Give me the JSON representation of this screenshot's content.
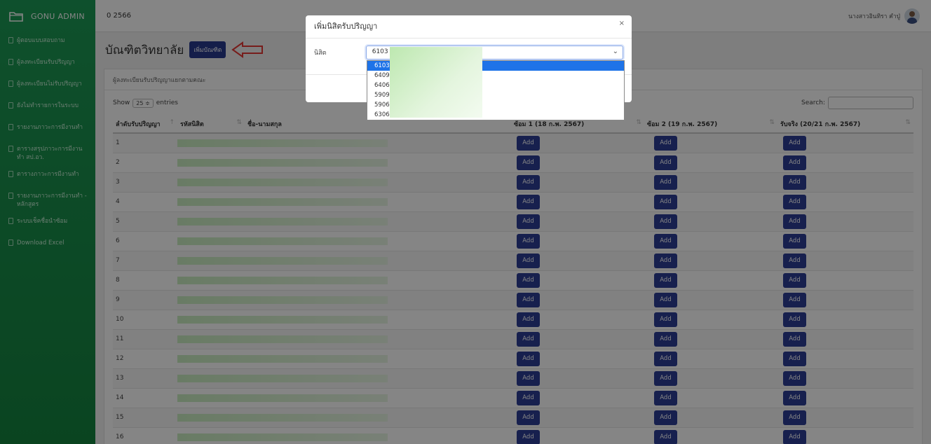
{
  "brand": {
    "name": "GONU ADMIN",
    "icon": "folder-icon"
  },
  "topbar": {
    "year": "0 2566",
    "user_name": "นางสาวอินทิรา คำปู่"
  },
  "sidebar": {
    "items": [
      {
        "label": "ผู้ตอบแบบสอบถาม"
      },
      {
        "label": "ผู้ลงทะเบียนรับปริญญา"
      },
      {
        "label": "ผู้ลงทะเบียนไม่รับปริญญา"
      },
      {
        "label": "ยังไม่ทำรายการในระบบ"
      },
      {
        "label": "รายงานภาวะการมีงานทำ"
      },
      {
        "label": "ตารางสรุปภาวะการมีงานทำ สป.อว."
      },
      {
        "label": "ตารางภาวะการมีงานทำ"
      },
      {
        "label": "รายงานภาวะการมีงานทำ - หลักสูตร"
      },
      {
        "label": "ระบบเช็คชื่อนำซ้อม"
      },
      {
        "label": "Download Excel"
      }
    ]
  },
  "page": {
    "title": "บัณฑิตวิทยาลัย",
    "add_button": "เพิ่มบัณฑิต"
  },
  "card": {
    "header": "ผู้ลงทะเบียนรับปริญญาแยกตามคณะ"
  },
  "controls": {
    "show": "Show",
    "length": "25 ≑",
    "entries": "entries",
    "search": "Search:"
  },
  "table": {
    "columns": [
      "ลำดับรับปริญญา",
      "รหัสนิสิต",
      "ชื่อ-นามสกุล",
      "ซ้อม 1 (18 ก.พ. 2567)",
      "ซ้อม 2 (19 ก.พ. 2567)",
      "รับจริง (20/21 ก.พ. 2567)"
    ],
    "add_label": "Add",
    "rows": [
      "1",
      "2",
      "3",
      "4",
      "5",
      "6",
      "7",
      "8",
      "9",
      "10",
      "11",
      "12",
      "13",
      "14",
      "15",
      "16"
    ]
  },
  "modal": {
    "title": "เพิ่มนิสิตรับปริญญา",
    "close": "×",
    "field_label": "นิสิต",
    "selected": "6103",
    "options": [
      "6103",
      "6409",
      "6406",
      "5909",
      "5906",
      "6306"
    ]
  },
  "colors": {
    "sidebar": "#1c9a56",
    "primary_button": "#2d3e96",
    "selected_option": "#1e73e8",
    "arrow": "#e53935"
  }
}
